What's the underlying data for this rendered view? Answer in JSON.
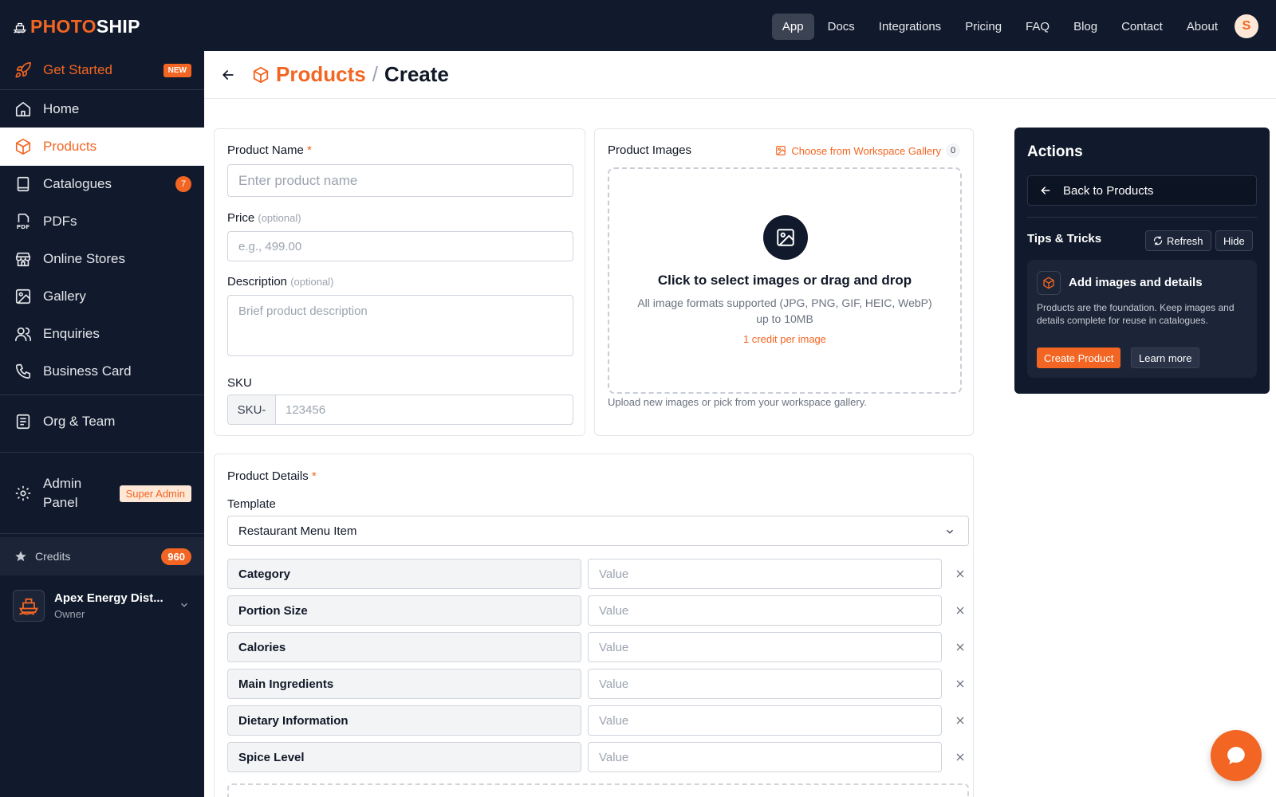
{
  "app": {
    "logo_part1": "PHOTO",
    "logo_part2": "SHIP",
    "user_initial": "S",
    "accent_color": "#f26522",
    "nav_bg_color": "#111a2c"
  },
  "topnav": {
    "items": [
      "App",
      "Docs",
      "Integrations",
      "Pricing",
      "FAQ",
      "Blog",
      "Contact",
      "About"
    ],
    "active": "App"
  },
  "sidebar": {
    "get_started": "Get Started",
    "new_badge": "NEW",
    "items": [
      {
        "label": "Home",
        "icon": "home-icon"
      },
      {
        "label": "Products",
        "icon": "box-icon"
      },
      {
        "label": "Catalogues",
        "icon": "book-icon",
        "badge": "7"
      },
      {
        "label": "PDFs",
        "icon": "pdf-icon"
      },
      {
        "label": "Online Stores",
        "icon": "store-icon"
      },
      {
        "label": "Gallery",
        "icon": "image-icon"
      },
      {
        "label": "Enquiries",
        "icon": "users-icon"
      },
      {
        "label": "Business Card",
        "icon": "phone-icon"
      },
      {
        "label": "Org & Team",
        "icon": "document-icon"
      }
    ],
    "active": "Products",
    "admin_label": "Admin Panel",
    "admin_badge": "Super Admin",
    "credits_label": "Credits",
    "credits_value": "960",
    "org_name": "Apex Energy Dist...",
    "org_role": "Owner"
  },
  "header": {
    "breadcrumb_products": "Products",
    "breadcrumb_sep": "/",
    "breadcrumb_current": "Create"
  },
  "form": {
    "name_label": "Product Name",
    "required_mark": "*",
    "name_placeholder": "Enter product name",
    "price_label": "Price",
    "optional_text": "(optional)",
    "price_placeholder": "e.g., 499.00",
    "description_label": "Description",
    "description_placeholder": "Brief product description",
    "sku_label": "SKU",
    "sku_prefix": "SKU-",
    "sku_placeholder": "123456"
  },
  "images": {
    "label": "Product Images",
    "gallery_link": "Choose from Workspace Gallery",
    "gallery_count": "0",
    "dropzone_title": "Click to select images or drag and drop",
    "dropzone_subtitle": "All image formats supported (JPG, PNG, GIF, HEIC, WebP) up to 10MB",
    "credit_note": "1 credit per image",
    "help_text": "Upload new images or pick from your workspace gallery."
  },
  "details": {
    "label": "Product Details",
    "template_label": "Template",
    "template_value": "Restaurant Menu Item",
    "value_placeholder": "Value",
    "rows": [
      "Category",
      "Portion Size",
      "Calories",
      "Main Ingredients",
      "Dietary Information",
      "Spice Level"
    ]
  },
  "actions": {
    "title": "Actions",
    "back_button": "Back to Products",
    "tips_title": "Tips & Tricks",
    "refresh_button": "Refresh",
    "hide_button": "Hide",
    "tip_heading": "Add images and details",
    "tip_body": "Products are the foundation. Keep images and details complete for reuse in catalogues.",
    "create_button": "Create Product",
    "learn_button": "Learn more"
  }
}
